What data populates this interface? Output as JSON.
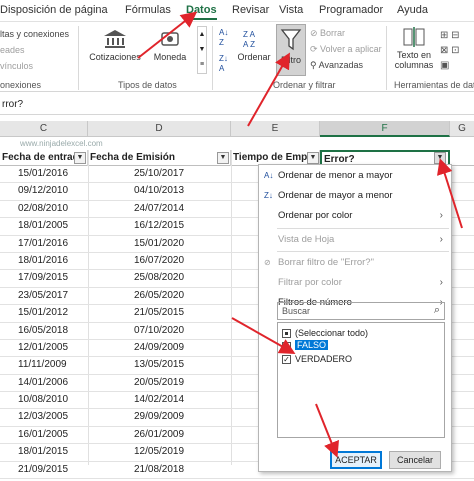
{
  "tabs": [
    "Disposición de página",
    "Fórmulas",
    "Datos",
    "Revisar",
    "Vista",
    "Programador",
    "Ayuda"
  ],
  "ribbon": {
    "conexiones_1": "ltas y conexiones",
    "conexiones_2": "eades",
    "conexiones_3": "vínculos",
    "conexiones_group": "onexiones",
    "cotizaciones": "Cotizaciones",
    "moneda": "Moneda",
    "tipos_group": "Tipos de datos",
    "ordenar": "Ordenar",
    "filtro": "Filtro",
    "borrar": "Borrar",
    "volver": "Volver a aplicar",
    "avanzadas": "Avanzadas",
    "ordenar_group": "Ordenar y filtrar",
    "texto_columnas": "Texto en columnas",
    "herramientas_group": "Herramientas de datos"
  },
  "formula_bar": {
    "content": "rror?"
  },
  "columns": [
    "C",
    "D",
    "E",
    "F",
    "G"
  ],
  "headers": [
    "Fecha de entrada",
    "Fecha de Emisión",
    "Tiempo de Empre",
    "Error?"
  ],
  "rows": [
    [
      "15/01/2016",
      "25/10/2017"
    ],
    [
      "09/12/2010",
      "04/10/2013"
    ],
    [
      "02/08/2010",
      "24/07/2014"
    ],
    [
      "18/01/2005",
      "16/12/2015"
    ],
    [
      "17/01/2016",
      "15/01/2020"
    ],
    [
      "18/01/2016",
      "16/07/2020"
    ],
    [
      "17/09/2015",
      "25/08/2020"
    ],
    [
      "23/05/2017",
      "26/05/2020"
    ],
    [
      "15/01/2012",
      "21/05/2015"
    ],
    [
      "16/05/2018",
      "07/10/2020"
    ],
    [
      "12/01/2005",
      "24/09/2009"
    ],
    [
      "11/11/2009",
      "13/05/2015"
    ],
    [
      "14/01/2006",
      "20/05/2019"
    ],
    [
      "10/08/2010",
      "14/02/2014"
    ],
    [
      "12/03/2005",
      "29/09/2009"
    ],
    [
      "16/01/2005",
      "26/01/2009"
    ],
    [
      "18/01/2015",
      "12/05/2019"
    ],
    [
      "21/09/2015",
      "21/08/2018"
    ]
  ],
  "watermark": "www.ninjadelexcel.com",
  "menu": {
    "sort_asc": "Ordenar de menor a mayor",
    "sort_desc": "Ordenar de mayor a menor",
    "sort_color": "Ordenar por color",
    "sheet_view": "Vista de Hoja",
    "clear_filter": "Borrar filtro de \"Error?\"",
    "filter_color": "Filtrar por color",
    "number_filters": "Filtros de número",
    "search_placeholder": "Buscar",
    "select_all": "(Seleccionar todo)",
    "falso": "FALSO",
    "verdadero": "VERDADERO",
    "ok": "ACEPTAR",
    "cancel": "Cancelar"
  },
  "colors": {
    "accent": "#1e7145",
    "arrow": "#e0242b",
    "selected": "#0078d7"
  }
}
